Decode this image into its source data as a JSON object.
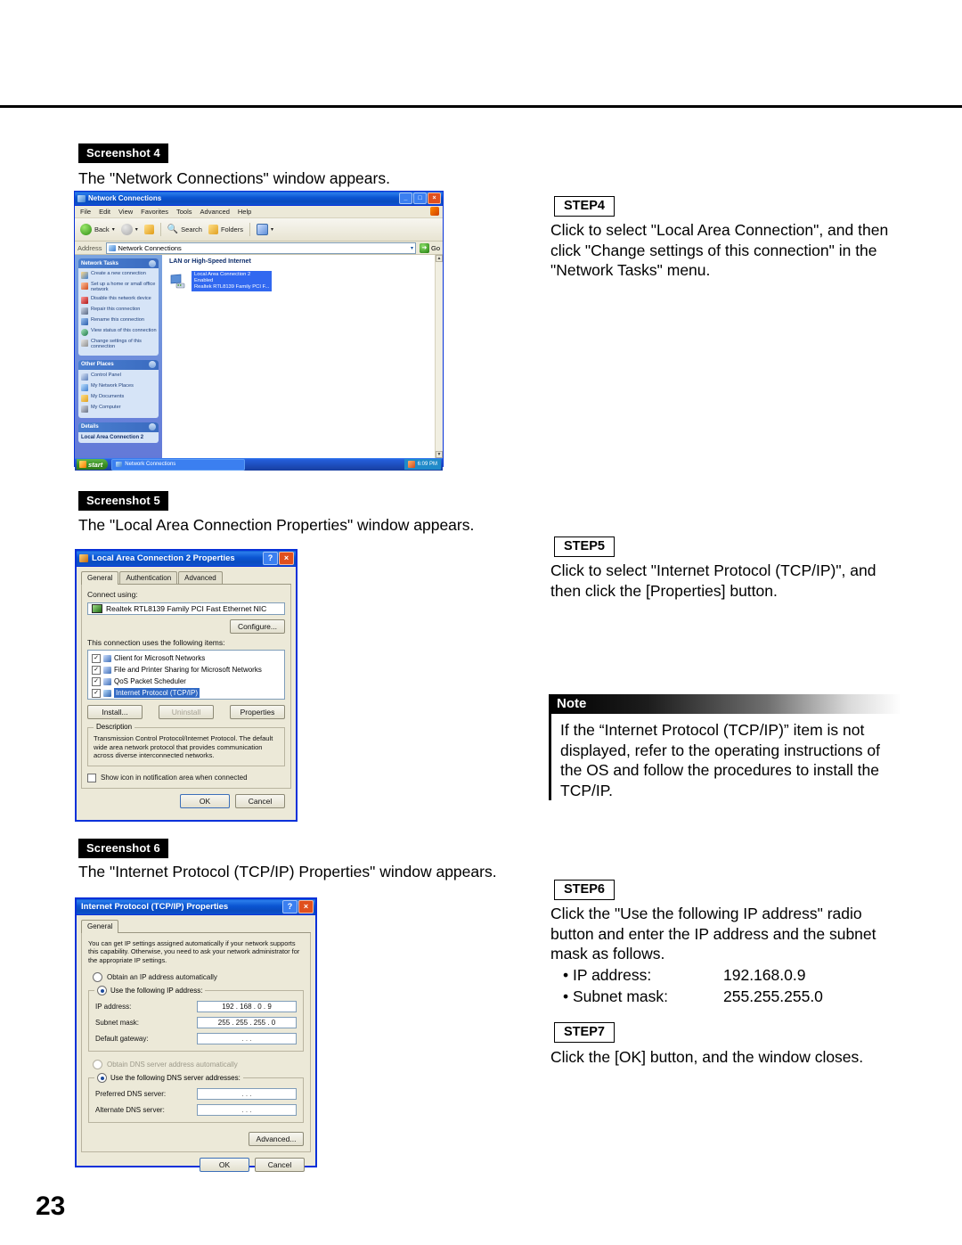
{
  "page": {
    "number": "23"
  },
  "sections": {
    "screenshot4": {
      "chip": "Screenshot 4",
      "caption": "The \"Network Connections\" window appears."
    },
    "screenshot5": {
      "chip": "Screenshot 5",
      "caption": "The \"Local Area Connection Properties\" window appears."
    },
    "screenshot6": {
      "chip": "Screenshot 6",
      "caption": "The \"Internet Protocol (TCP/IP) Properties\" window appears."
    }
  },
  "steps": {
    "step4": {
      "chip": "STEP4",
      "text": "Click to select \"Local Area Connection\", and then click \"Change settings of this connection\" in the \"Network Tasks\" menu."
    },
    "step5": {
      "chip": "STEP5",
      "text": "Click to select \"Internet Protocol (TCP/IP)\", and then click the [Properties] button."
    },
    "step6": {
      "chip": "STEP6",
      "text": "Click the \"Use the following IP address\" radio button and enter the IP address and the subnet mask as follows.",
      "bullets": [
        {
          "label": "• IP address:",
          "value": "192.168.0.9"
        },
        {
          "label": "• Subnet mask:",
          "value": "255.255.255.0"
        }
      ]
    },
    "step7": {
      "chip": "STEP7",
      "text": "Click the [OK] button, and the window closes."
    }
  },
  "note": {
    "heading": "Note",
    "text": "If the “Internet Protocol (TCP/IP)” item is not displayed, refer to the operating instructions of the OS and follow the procedures to install the TCP/IP."
  },
  "network_connections": {
    "title": "Network Connections",
    "titlebar_icon": "network-icon",
    "window_buttons": {
      "minimize": "_",
      "maximize": "□",
      "close": "×"
    },
    "menus": [
      "File",
      "Edit",
      "View",
      "Favorites",
      "Tools",
      "Advanced",
      "Help"
    ],
    "toolbar": {
      "back": "Back",
      "forward": "",
      "up": "",
      "search": "Search",
      "folders": "Folders",
      "views": ""
    },
    "address": {
      "label": "Address",
      "value": "Network Connections",
      "go": "Go"
    },
    "task_pane": {
      "network_tasks": {
        "heading": "Network Tasks",
        "items": [
          "Create a new connection",
          "Set up a home or small office network",
          "Disable this network device",
          "Repair this connection",
          "Rename this connection",
          "View status of this connection",
          "Change settings of this connection"
        ]
      },
      "other_places": {
        "heading": "Other Places",
        "items": [
          "Control Panel",
          "My Network Places",
          "My Documents",
          "My Computer"
        ]
      },
      "details": {
        "heading": "Details",
        "name": "Local Area Connection 2"
      }
    },
    "content": {
      "group_title": "LAN or High-Speed Internet",
      "connection": {
        "name": "Local Area Connection 2",
        "status": "Enabled",
        "adapter": "Realtek RTL8139 Family PCI F..."
      }
    },
    "taskbar": {
      "start": "start",
      "task": "Network Connections",
      "clock": "6:09 PM"
    }
  },
  "lan_properties": {
    "title": "Local Area Connection 2 Properties",
    "help_button": "?",
    "close_button": "×",
    "tabs": [
      "General",
      "Authentication",
      "Advanced"
    ],
    "active_tab": "General",
    "connect_using_label": "Connect using:",
    "adapter": "Realtek RTL8139 Family PCI Fast Ethernet NIC",
    "configure_button": "Configure...",
    "items_label": "This connection uses the following items:",
    "items": [
      {
        "label": "Client for Microsoft Networks",
        "checked": true,
        "selected": false
      },
      {
        "label": "File and Printer Sharing for Microsoft Networks",
        "checked": true,
        "selected": false
      },
      {
        "label": "QoS Packet Scheduler",
        "checked": true,
        "selected": false
      },
      {
        "label": "Internet Protocol (TCP/IP)",
        "checked": true,
        "selected": true
      }
    ],
    "buttons": {
      "install": "Install...",
      "uninstall": "Uninstall",
      "properties": "Properties"
    },
    "description_label": "Description",
    "description": "Transmission Control Protocol/Internet Protocol. The default wide area network protocol that provides communication across diverse interconnected networks.",
    "show_icon_label": "Show icon in notification area when connected",
    "show_icon_checked": false,
    "footer": {
      "ok": "OK",
      "cancel": "Cancel"
    }
  },
  "tcpip_properties": {
    "title": "Internet Protocol (TCP/IP) Properties",
    "help_button": "?",
    "close_button": "×",
    "tabs": [
      "General"
    ],
    "active_tab": "General",
    "intro": "You can get IP settings assigned automatically if your network supports this capability. Otherwise, you need to ask your network administrator for the appropriate IP settings.",
    "obtain_ip_label": "Obtain an IP address automatically",
    "obtain_ip_selected": false,
    "use_ip_label": "Use the following IP address:",
    "use_ip_selected": true,
    "fields": [
      {
        "label": "IP address:",
        "value": "192 . 168 .  0  .  9",
        "empty": false
      },
      {
        "label": "Subnet mask:",
        "value": "255 . 255 . 255 .  0",
        "empty": false
      },
      {
        "label": "Default gateway:",
        "value": ".      .      .",
        "empty": true
      }
    ],
    "obtain_dns_label": "Obtain DNS server address automatically",
    "obtain_dns_selected": false,
    "obtain_dns_disabled": true,
    "use_dns_label": "Use the following DNS server addresses:",
    "use_dns_selected": true,
    "dns_fields": [
      {
        "label": "Preferred DNS server:",
        "value": ".      .      .",
        "empty": true
      },
      {
        "label": "Alternate DNS server:",
        "value": ".      .      .",
        "empty": true
      }
    ],
    "advanced_button": "Advanced...",
    "footer": {
      "ok": "OK",
      "cancel": "Cancel"
    }
  }
}
